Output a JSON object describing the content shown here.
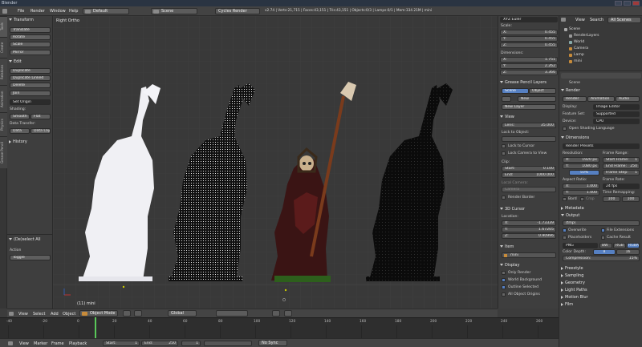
{
  "window": {
    "title": "Blender"
  },
  "topbar": {
    "menus": [
      "File",
      "Render",
      "Window",
      "Help"
    ],
    "layout": "Default",
    "scene": "Scene",
    "engine": "Cycles Render",
    "stats": "v2.74 | Verts:21,715 | Faces:43,151 | Tris:43,151 | Objects:0/3 | Lamps:0/1 | Mem:334.21M | mini"
  },
  "left_tabs": [
    "Tools",
    "Create",
    "Relations",
    "Animation",
    "Physics",
    "Grease Pencil"
  ],
  "tools": {
    "transform_header": "Transform",
    "transform_buttons": [
      "Translate",
      "Rotate",
      "Scale",
      "Mirror"
    ],
    "edit_header": "Edit",
    "edit_buttons": [
      "Duplicate",
      "Duplicate Linked",
      "Delete",
      "Join"
    ],
    "set_origin": "Set Origin",
    "shading_label": "Shading:",
    "smooth": "Smooth",
    "flat": "Flat",
    "data_transfer_label": "Data Transfer:",
    "data": "Data",
    "data_layout": "Data Layo",
    "history_header": "History",
    "operator_header": "(De)select All",
    "action_label": "Action",
    "action_value": "Toggle"
  },
  "viewport": {
    "view_label": "Right Ortho",
    "object_label": "(11) mini"
  },
  "vpheader": {
    "items": [
      "View",
      "Select",
      "Add",
      "Object"
    ],
    "mode": "Object Mode",
    "orientation": "Global"
  },
  "timeline": {
    "ticks": [
      "-40",
      "-20",
      "0",
      "20",
      "40",
      "60",
      "80",
      "100",
      "120",
      "140",
      "160",
      "180",
      "200",
      "220",
      "240",
      "260"
    ],
    "current_frame": 1,
    "header_items": [
      "View",
      "Marker",
      "Frame",
      "Playback"
    ],
    "start_label": "Start:",
    "start_value": "1",
    "end_label": "End:",
    "end_value": "250",
    "frame_value": "1",
    "sync": "No Sync"
  },
  "npanel": {
    "rotation_mode": "XYZ Euler",
    "scale_label": "Scale:",
    "scale": [
      {
        "axis": "X:",
        "value": "0.455"
      },
      {
        "axis": "Y:",
        "value": "0.455"
      },
      {
        "axis": "Z:",
        "value": "0.455"
      }
    ],
    "dimensions_label": "Dimensions:",
    "dimensions": [
      {
        "axis": "X:",
        "value": "1.751"
      },
      {
        "axis": "Y:",
        "value": "2.262"
      },
      {
        "axis": "Z:",
        "value": "3.366"
      }
    ],
    "grease_header": "Grease Pencil Layers",
    "scene_tab": "Scene",
    "object_tab": "Object",
    "new_btn": "New",
    "new_layer_btn": "New Layer",
    "view_header": "View",
    "lens_label": "Lens:",
    "lens_value": "35.000",
    "lock_to_object": "Lock to Object:",
    "lock_to_cursor": "Lock to Cursor",
    "lock_camera": "Lock Camera to View",
    "clip_label": "Clip:",
    "clip_start_label": "Start:",
    "clip_start": "0.100",
    "clip_end_label": "End:",
    "clip_end": "1000.000",
    "local_camera": "Local Camera:",
    "camera": "Camera",
    "render_border": "Render Border",
    "cursor_header": "3D Cursor",
    "location_label": "Location:",
    "location": [
      {
        "axis": "X:",
        "value": "-1.73339"
      },
      {
        "axis": "Y:",
        "value": "1.67205"
      },
      {
        "axis": "Z:",
        "value": "0.90996"
      }
    ],
    "item_header": "Item",
    "item_name": "mini",
    "display_header": "Display",
    "display_items": [
      "Only Render",
      "World Background",
      "Outline Selected",
      "All Object Origins"
    ]
  },
  "outliner": {
    "tabs": [
      "View",
      "Search",
      "All Scenes"
    ],
    "items": [
      "Scene",
      "RenderLayers",
      "World",
      "Camera",
      "Lamp",
      "mini"
    ]
  },
  "props": {
    "scene_name": "Scene",
    "render_header": "Render",
    "render_btn": "Render",
    "animation_btn": "Animation",
    "audio_btn": "Audio",
    "display_label": "Display:",
    "display_value": "Image Editor",
    "feature_label": "Feature Set:",
    "feature_value": "Supported",
    "device_label": "Device:",
    "device_value": "CPU",
    "osl": "Open Shading Language",
    "dimensions_header": "Dimensions",
    "presets": "Render Presets",
    "resolution_label": "Resolution:",
    "res_x_label": "X:",
    "res_x": "1920 px",
    "res_y_label": "Y:",
    "res_y": "1080 px",
    "res_pct": "50%",
    "frame_range_label": "Frame Range:",
    "start_frame_label": "Start Frame:",
    "start_frame": "1",
    "end_frame_label": "End Frame:",
    "end_frame": "250",
    "frame_step_label": "Frame Step:",
    "frame_step": "1",
    "aspect_label": "Aspect Ratio:",
    "aspect_x_label": "X:",
    "aspect_x": "1.000",
    "aspect_y_label": "Y:",
    "aspect_y": "1.000",
    "frame_rate_label": "Frame Rate:",
    "frame_rate": "24 fps",
    "time_remap_label": "Time Remapping:",
    "remap_old": "100",
    "remap_new": "100",
    "border": "Bord",
    "crop": "Crop",
    "metadata_header": "Metadata",
    "output_header": "Output",
    "output_path": "/tmp\\",
    "overwrite": "Overwrite",
    "file_ext": "File Extensions",
    "placeholders": "Placeholders",
    "cache_result": "Cache Result",
    "format": "PNG",
    "bw": "BW",
    "rgb": "RGB",
    "rgba": "RGBA",
    "color_depth_label": "Color Depth:",
    "depth_8": "8",
    "depth_16": "16",
    "compression_label": "Compression:",
    "compression_value": "15%",
    "collapsed": [
      "Freestyle",
      "Sampling",
      "Geometry",
      "Light Paths",
      "Motion Blur",
      "Film"
    ]
  }
}
